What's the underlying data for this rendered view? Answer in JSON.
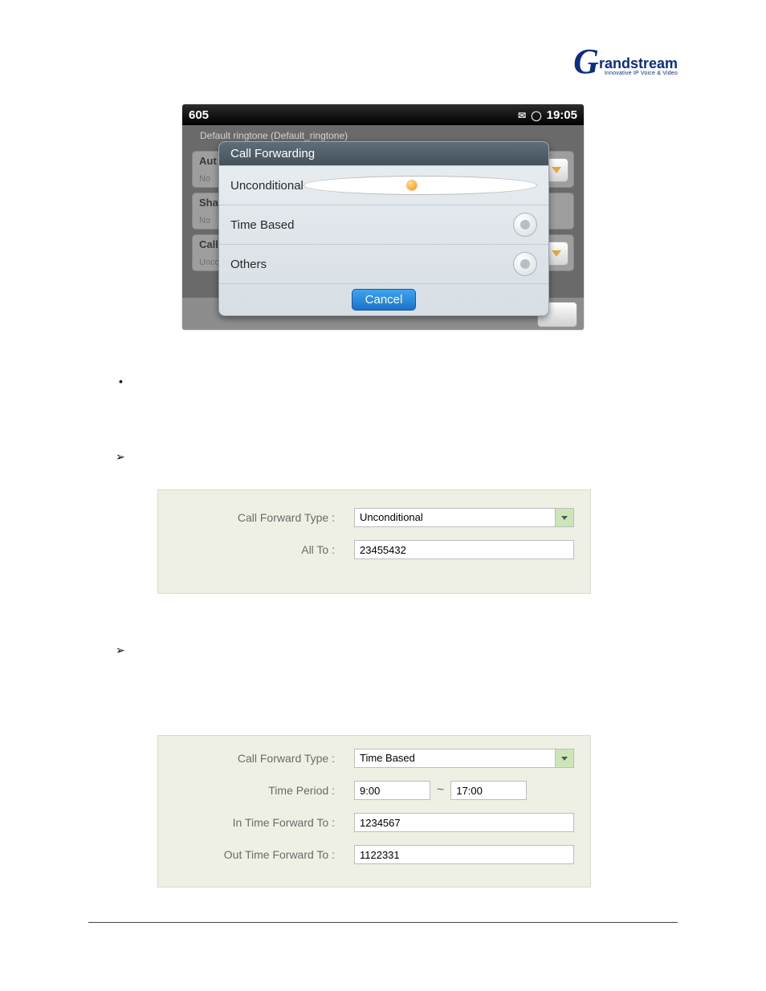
{
  "brand": {
    "name": "Grandstream",
    "stream": "randstream",
    "tagline": "Innovative IP Voice & Video"
  },
  "phone": {
    "account": "605",
    "time": "19:05",
    "ringtone_line": "Default ringtone (Default_ringtone)",
    "bg_rows": [
      {
        "title": "Aut",
        "sub": "No"
      },
      {
        "title": "Sha",
        "sub": "No"
      },
      {
        "title": "Call",
        "sub": "Unco"
      }
    ],
    "dialog": {
      "title": "Call Forwarding",
      "options": [
        "Unconditional",
        "Time Based",
        "Others"
      ],
      "selected_index": 0,
      "cancel": "Cancel"
    }
  },
  "forms": {
    "unconditional": {
      "type_label": "Call Forward Type :",
      "type_value": "Unconditional",
      "all_to_label": "All To :",
      "all_to_value": "23455432"
    },
    "timebased": {
      "type_label": "Call Forward Type :",
      "type_value": "Time Based",
      "period_label": "Time Period :",
      "period_from": "9:00",
      "tilde": "~",
      "period_to": "17:00",
      "in_label": "In Time Forward To :",
      "in_value": "1234567",
      "out_label": "Out Time Forward To :",
      "out_value": "1122331"
    }
  }
}
